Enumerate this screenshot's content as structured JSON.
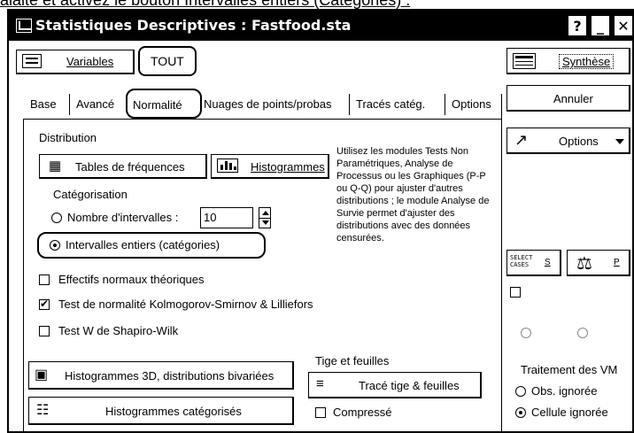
{
  "instruction_fragment": "alaite et activez le bouton Intervalles entiers (Catégories) .",
  "window": {
    "title": "Statistiques Descriptives : Fastfood.sta",
    "help_label": "?",
    "minimize_label": "_",
    "close_label": "✕"
  },
  "top": {
    "variables_label": "Variables",
    "tout_label": "TOUT"
  },
  "right": {
    "synthese_label": "Synthèse",
    "annuler_label": "Annuler",
    "options_label": "Options",
    "select_cases_line1": "SELECT",
    "select_cases_line2": "CASES",
    "s_label": "S",
    "p_label": "P",
    "traitement_vm_label": "Traitement des VM",
    "obs_ignoree_label": "Obs. ignorée",
    "cellule_ignoree_label": "Cellule ignorée"
  },
  "tabs": [
    {
      "label": "Base"
    },
    {
      "label": "Avancé"
    },
    {
      "label": "Normalité"
    },
    {
      "label": "Nuages de points/probas"
    },
    {
      "label": "Tracés catég."
    },
    {
      "label": "Options"
    }
  ],
  "normalite": {
    "distribution_label": "Distribution",
    "tables_frequences_label": "Tables de fréquences",
    "histogrammes_label": "Histogrammes",
    "categorisation_label": "Catégorisation",
    "nombre_intervalles_label": "Nombre d'intervalles :",
    "nombre_intervalles_value": "10",
    "intervalles_entiers_label": "Intervalles entiers (catégories)",
    "effectifs_label": "Effectifs normaux théoriques",
    "ks_test_label": "Test de normalité Kolmogorov-Smirnov & Lilliefors",
    "shapiro_label": "Test W de Shapiro-Wilk",
    "hist3d_label": "Histogrammes 3D, distributions bivariées",
    "hist_cat_label": "Histogrammes catégorisés",
    "tige_title": "Tige et feuilles",
    "trace_tige_label": "Tracé tige & feuilles",
    "compresse_label": "Compressé",
    "info_text": "Utilisez les modules Tests Non Paramétriques, Analyse de Processus ou les Graphiques (P-P ou Q-Q) pour ajuster d'autres distributions ; le module Analyse de Survie permet d'ajuster des distributions avec des données censurées."
  },
  "state": {
    "selected_tab": "Normalité",
    "categorisation_selected": "Intervalles entiers (catégories)",
    "effectifs_checked": false,
    "ks_checked": true,
    "shapiro_checked": false,
    "compresse_checked": false,
    "vm_selected": "Cellule ignorée"
  }
}
